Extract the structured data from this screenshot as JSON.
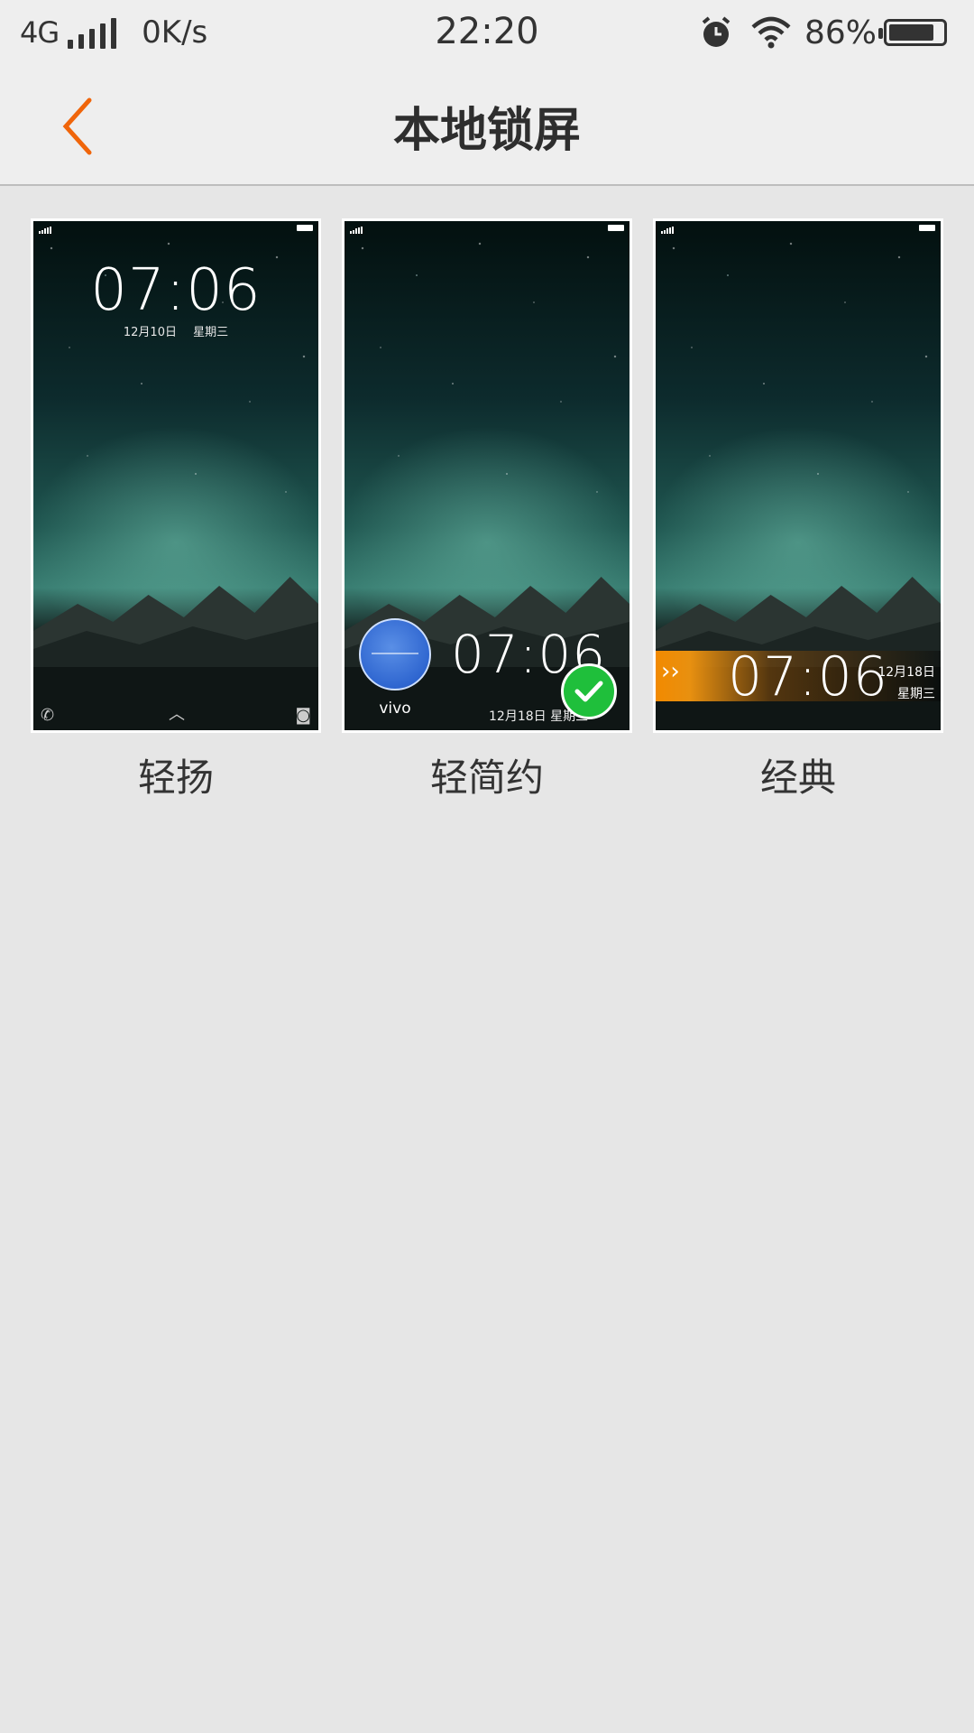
{
  "status_bar": {
    "network": "4G",
    "speed": "0K/s",
    "time": "22:20",
    "battery_text": "86%",
    "battery_level": 0.86,
    "icons": [
      "signal-icon",
      "alarm-icon",
      "wifi-icon",
      "battery-icon"
    ]
  },
  "header": {
    "title": "本地锁屏",
    "back_icon": "chevron-left-icon",
    "accent": "#f0650a"
  },
  "styles": [
    {
      "label": "轻扬",
      "lock_time": "07:06",
      "lock_date": "12月10日 星期三",
      "selected": false
    },
    {
      "label": "轻简约",
      "lock_time": "07:06",
      "lock_date": "12月18日 星期三",
      "brand": "vivo",
      "selected": true
    },
    {
      "label": "经典",
      "lock_time": "07:06",
      "lock_date_line1": "12月18日",
      "lock_date_line2": "星期三",
      "selected": false
    }
  ],
  "colors": {
    "background": "#e6e6e6",
    "selected_badge": "#1fbf3b",
    "classic_bar": "#f28a00"
  }
}
